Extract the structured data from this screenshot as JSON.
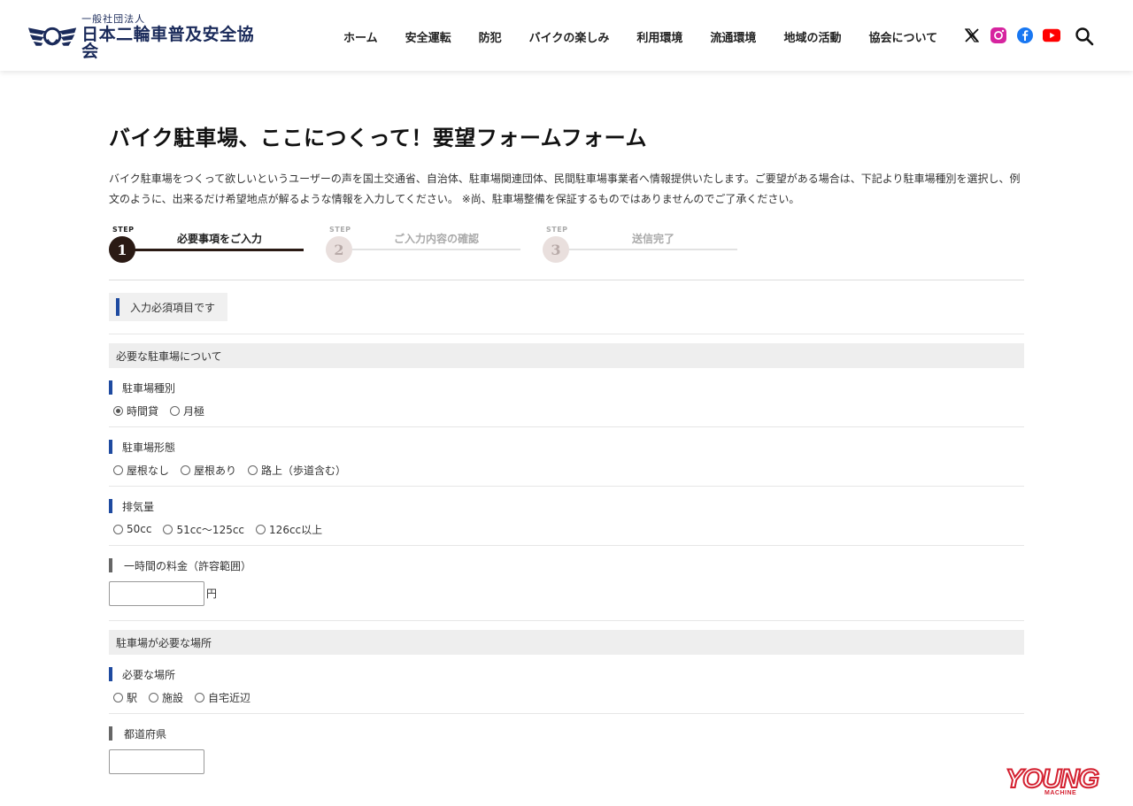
{
  "header": {
    "logo_sub": "一般社団法人",
    "logo_main": "日本二輪車普及安全協会",
    "nav": [
      "ホーム",
      "安全運転",
      "防犯",
      "バイクの楽しみ",
      "利用環境",
      "流通環境",
      "地域の活動",
      "協会について"
    ],
    "social_icons": [
      "x-icon",
      "instagram-icon",
      "facebook-icon",
      "youtube-icon"
    ],
    "colors": {
      "brand": "#1a2a5a",
      "instagram": "#d6249f",
      "facebook": "#1877f2",
      "youtube": "#ff0000"
    }
  },
  "page": {
    "title": "バイク駐車場、ここにつくって！要望フォームフォーム",
    "intro": "バイク駐車場をつくって欲しいというユーザーの声を国土交通省、自治体、駐車場関連団体、民間駐車場事業者へ情報提供いたします。ご要望がある場合は、下記より駐車場種別を選択し、例文のように、出来るだけ希望地点が解るような情報を入力してください。 ※尚、駐車場整備を保証するものではありませんのでご了承ください。"
  },
  "steps": [
    {
      "tag": "STEP",
      "num": "1",
      "label": "必要事項をご入力",
      "state": "active"
    },
    {
      "tag": "STEP",
      "num": "2",
      "label": "ご入力内容の確認",
      "state": "inactive"
    },
    {
      "tag": "STEP",
      "num": "3",
      "label": "送信完了",
      "state": "inactive"
    }
  ],
  "form": {
    "required_note": "入力必須項目です",
    "accent_color": "#1e4aa0",
    "section1": {
      "heading": "必要な駐車場について",
      "fields": {
        "type": {
          "label": "駐車場種別",
          "options": [
            "時間貸",
            "月極"
          ],
          "selected": "時間貸"
        },
        "form": {
          "label": "駐車場形態",
          "options": [
            "屋根なし",
            "屋根あり",
            "路上（歩道含む）"
          ]
        },
        "cc": {
          "label": "排気量",
          "options": [
            "50cc",
            "51cc〜125cc",
            "126cc以上"
          ]
        },
        "fee": {
          "label": "一時間の料金（許容範囲）",
          "value": "",
          "unit": "円"
        }
      }
    },
    "section2": {
      "heading": "駐車場が必要な場所",
      "fields": {
        "place": {
          "label": "必要な場所",
          "options": [
            "駅",
            "施設",
            "自宅近辺"
          ]
        },
        "pref": {
          "label": "都道府県",
          "value": ""
        }
      }
    }
  },
  "watermark": {
    "main": "YOUNG",
    "sub": "MACHINE",
    "color": "#d42030"
  }
}
